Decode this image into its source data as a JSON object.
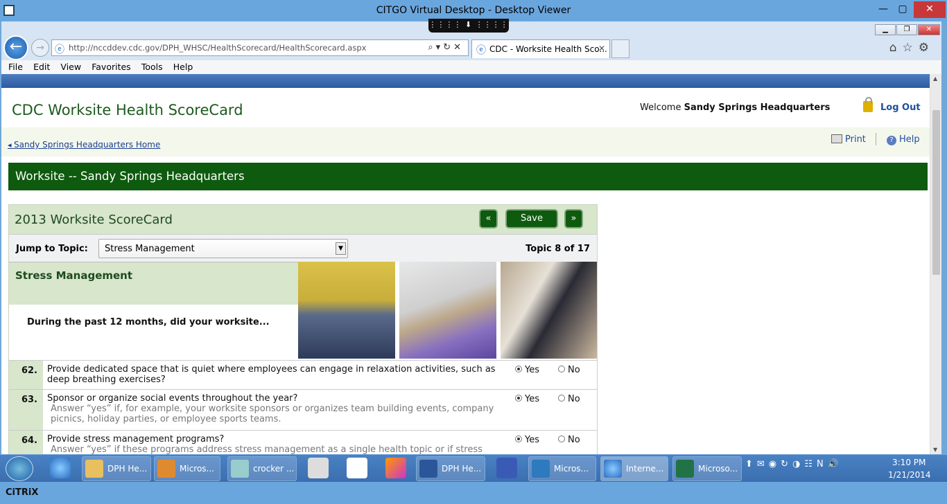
{
  "citrix": {
    "window_title": "CITGO Virtual Desktop - Desktop Viewer",
    "toolbar_tab": "⋮⋮⋮⋮ ⬇ ⋮⋮⋮⋮",
    "logo": "CiTRiX"
  },
  "browser": {
    "url": "http://nccddev.cdc.gov/DPH_WHSC/HealthScorecard/HealthScorecard.aspx",
    "tab_title": "CDC - Worksite Health Sco...",
    "menu": [
      "File",
      "Edit",
      "View",
      "Favorites",
      "Tools",
      "Help"
    ]
  },
  "header": {
    "site_title": "CDC Worksite Health ScoreCard",
    "welcome_prefix": "Welcome ",
    "welcome_name": "Sandy Springs Headquarters",
    "logout_label": "Log Out"
  },
  "subheader": {
    "home_link": "Sandy Springs Headquarters Home",
    "print_label": "Print",
    "help_label": "Help"
  },
  "worksite_band": "Worksite -- Sandy Springs Headquarters",
  "scorecard": {
    "title": "2013 Worksite ScoreCard",
    "prev_label": "«",
    "save_label": "Save",
    "next_label": "»",
    "jump_label": "Jump to Topic:",
    "selected_topic": "Stress Management",
    "topic_count": "Topic 8 of 17",
    "topic_name": "Stress Management",
    "question_intro": "During the past 12 months, did your worksite...",
    "questions": [
      {
        "num": "62.",
        "text": "Provide dedicated space that is quiet where employees can engage in relaxation activities, such as deep breathing exercises?",
        "hint": "",
        "answer": "Yes"
      },
      {
        "num": "63.",
        "text": "Sponsor or organize social events throughout the year?",
        "hint": "Answer “yes” if, for example, your worksite sponsors or organizes team building events, company picnics, holiday parties, or employee sports teams.",
        "answer": "Yes"
      },
      {
        "num": "64.",
        "text": "Provide stress management programs?",
        "hint": "Answer “yes” if these programs address stress management as a single health topic or if stress",
        "answer": "Yes"
      }
    ],
    "yes_label": "Yes",
    "no_label": "No"
  },
  "taskbar": {
    "items": [
      "DPH He...",
      "Micros...",
      "crocker ...",
      "DPH He...",
      "Micros...",
      "Interne...",
      "Microso..."
    ],
    "time": "3:10 PM",
    "date": "1/21/2014"
  }
}
